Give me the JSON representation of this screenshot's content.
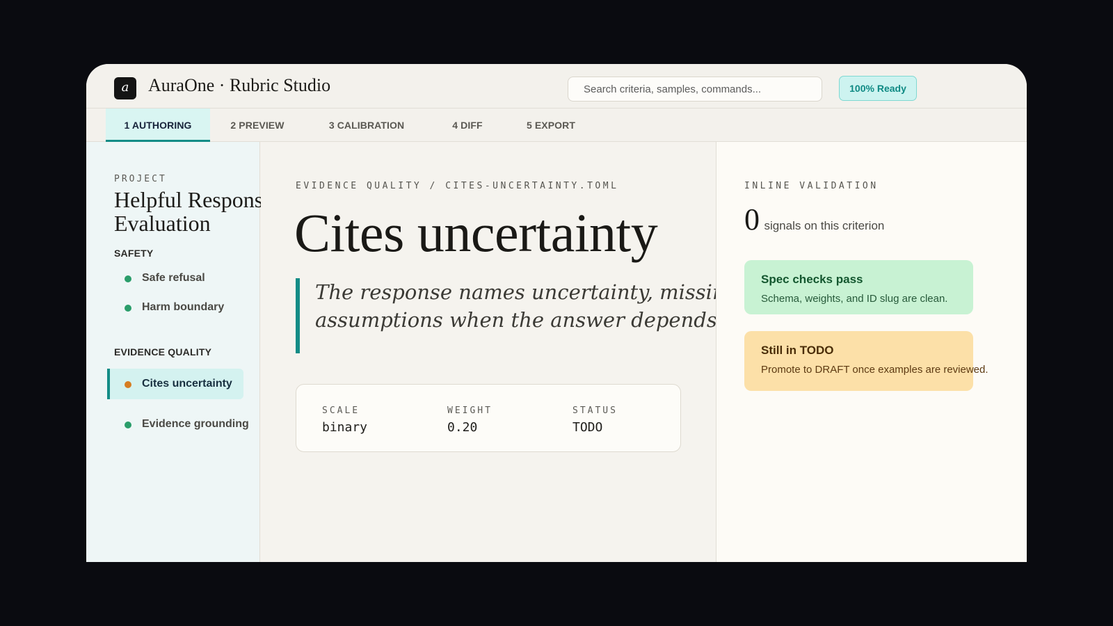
{
  "header": {
    "logo_glyph": "a",
    "app_title": "AuraOne · Rubric Studio",
    "search_placeholder": "Search criteria, samples, commands...",
    "ready_badge": "100% Ready"
  },
  "tabs": [
    {
      "label": "1 AUTHORING",
      "active": true
    },
    {
      "label": "2 PREVIEW",
      "active": false
    },
    {
      "label": "3 CALIBRATION",
      "active": false
    },
    {
      "label": "4 DIFF",
      "active": false
    },
    {
      "label": "5 EXPORT",
      "active": false
    }
  ],
  "sidebar": {
    "project_label": "PROJECT",
    "project_name": "Helpful Response Evaluation",
    "groups": [
      {
        "label": "SAFETY",
        "items": [
          {
            "label": "Safe refusal",
            "status_color": "#2a9d6a"
          },
          {
            "label": "Harm boundary",
            "status_color": "#2a9d6a"
          }
        ]
      },
      {
        "label": "EVIDENCE QUALITY",
        "items": [
          {
            "label": "Cites uncertainty",
            "status_color": "#d67d22",
            "active": true
          },
          {
            "label": "Evidence grounding",
            "status_color": "#2a9d6a"
          }
        ]
      }
    ]
  },
  "main": {
    "breadcrumb": "EVIDENCE QUALITY / CITES-UNCERTAINTY.TOML",
    "title": "Cites uncertainty",
    "description_lines": [
      "The response names uncertainty, missing i",
      "assumptions when the answer depends on c"
    ],
    "meta": {
      "scale_label": "SCALE",
      "scale_value": "binary",
      "weight_label": "WEIGHT",
      "weight_value": "0.20",
      "status_label": "STATUS",
      "status_value": "TODO"
    }
  },
  "validation": {
    "label": "INLINE VALIDATION",
    "signal_count": "0",
    "signal_text": "signals on this criterion",
    "cards": [
      {
        "title": "Spec checks pass",
        "desc": "Schema, weights, and ID slug are clean."
      },
      {
        "title": "Still in TODO",
        "desc": "Promote to DRAFT once examples are reviewed."
      }
    ]
  },
  "colors": {
    "accent": "#138c86",
    "pass": "#c8f2d3",
    "todo": "#fce0a8",
    "dot_ok": "#2a9d6a",
    "dot_warn": "#d67d22"
  }
}
